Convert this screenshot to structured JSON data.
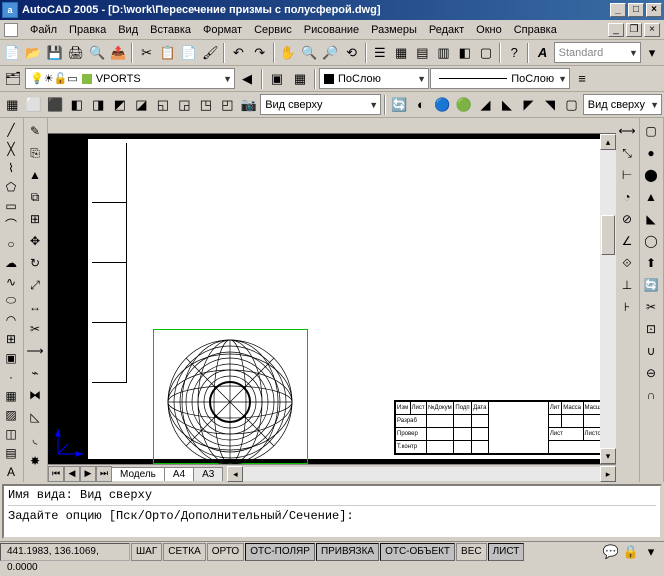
{
  "title": "AutoCAD 2005 - [D:\\work\\Пересечение призмы с полусферой.dwg]",
  "app_icon_text": "a",
  "menu": [
    "Файл",
    "Правка",
    "Вид",
    "Вставка",
    "Формат",
    "Сервис",
    "Рисование",
    "Размеры",
    "Редакт",
    "Окно",
    "Справка"
  ],
  "toolbar1": {
    "style_font_label": "A",
    "style_name": "Standard"
  },
  "toolbar2": {
    "layer_name": "VPORTS",
    "color_name": "ПоСлою",
    "linetype_name": "ПоСлою"
  },
  "toolbar3": {
    "view_name": "Вид сверху",
    "view_name2": "Вид сверху"
  },
  "tabs": {
    "items": [
      "Модель",
      "A4",
      "A3"
    ],
    "active": 2
  },
  "cmd": {
    "line1": "Имя вида: Вид сверху",
    "line2": "Задайте опцию [Пск/Орто/Дополнительный/Сечение]:"
  },
  "status": {
    "coords": "441.1983, 136.1069, 0.0000",
    "buttons": [
      "ШАГ",
      "СЕТКА",
      "ОРТО",
      "ОТС-ПОЛЯР",
      "ПРИВЯЗКА",
      "ОТС-ОБЪЕКТ",
      "ВЕС",
      "ЛИСТ"
    ],
    "pressed": [
      false,
      false,
      false,
      true,
      true,
      true,
      false,
      true
    ]
  },
  "titleblock": {
    "h1": [
      "Изм",
      "Лист",
      "№Докум",
      "Подп",
      "Дата"
    ],
    "r1": [
      "Разраб",
      "",
      "",
      ""
    ],
    "r2": [
      "Провер",
      "",
      "",
      ""
    ],
    "r3": [
      "Т.контр",
      "",
      "",
      ""
    ],
    "h2": [
      "Лит",
      "Масса",
      "Масштаб"
    ],
    "r4": [
      "Лист",
      "Листов"
    ]
  }
}
